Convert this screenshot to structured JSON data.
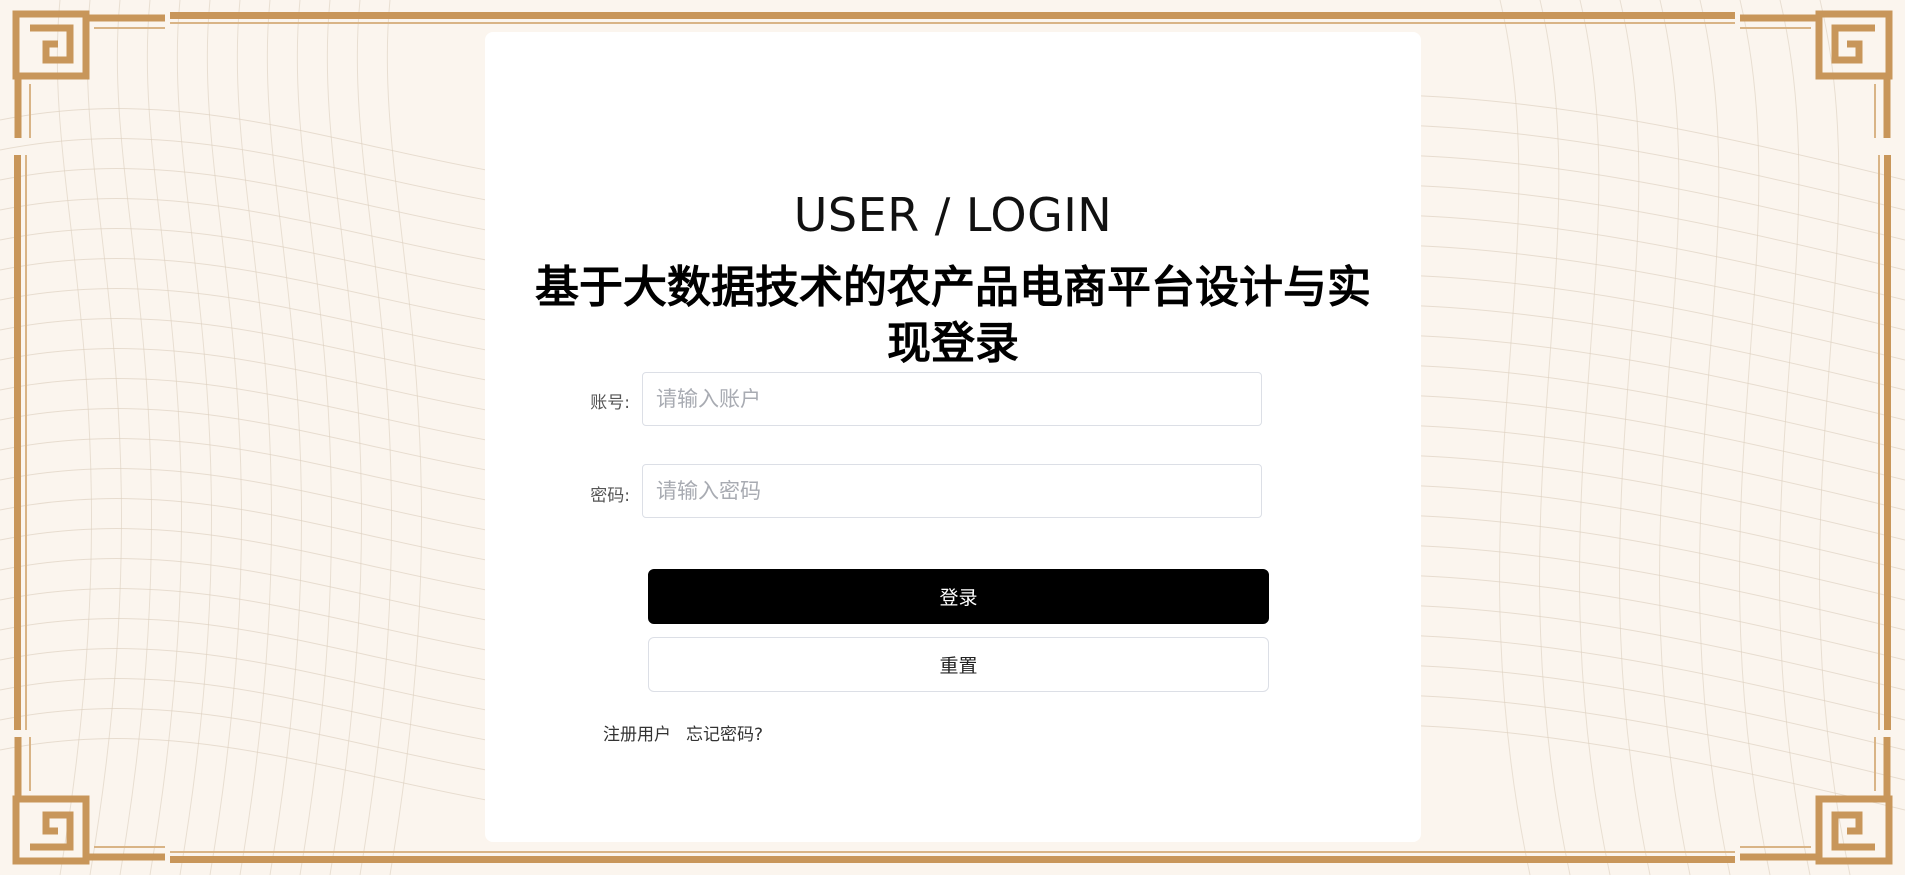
{
  "login": {
    "heading_en": "USER / LOGIN",
    "title": "基于大数据技术的农产品电商平台设计与实现登录",
    "account_label": "账号:",
    "account_placeholder": "请输入账户",
    "password_label": "密码:",
    "password_placeholder": "请输入密码",
    "login_button": "登录",
    "reset_button": "重置",
    "register_link": "注册用户",
    "forgot_link": "忘记密码?"
  },
  "theme": {
    "background": "#fbf5ee",
    "border_gold": "#c8965a",
    "card": "#ffffff",
    "primary_button": "#000000"
  }
}
